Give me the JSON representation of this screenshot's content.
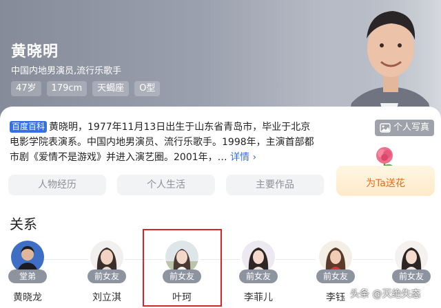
{
  "hero": {
    "name": "黄晓明",
    "description": "中国内地男演员,流行乐歌手",
    "tags": [
      "47岁",
      "179cm",
      "天蝎座",
      "O型"
    ],
    "photo_button": "个人写真"
  },
  "intro": {
    "source_badge": "百度百科",
    "text": "黄晓明，1977年11月13日出生于山东省青岛市，毕业于北京电影学院表演系。中国内地男演员、流行乐歌手。1998年，主演首部都市剧《爱情不是游戏》并进入演艺圈。2001年，…",
    "more_link": "详情 ›"
  },
  "flower_button": "为Ta送花",
  "tabs": [
    "人物经历",
    "个人生活",
    "主要作品"
  ],
  "relations": {
    "title": "关系",
    "items": [
      {
        "relation": "堂弟",
        "name": "黄晓龙"
      },
      {
        "relation": "前女友",
        "name": "刘立淇"
      },
      {
        "relation": "前女友",
        "name": "叶珂"
      },
      {
        "relation": "前女友",
        "name": "李菲儿"
      },
      {
        "relation": "前女友",
        "name": "李钰"
      },
      {
        "relation": "前女友",
        "name": ""
      }
    ]
  },
  "watermark": "头条 @灭绝失态",
  "colors": {
    "accent": "#3670e3",
    "highlight_box": "#d9232a",
    "flower_text": "#ea6a17"
  }
}
